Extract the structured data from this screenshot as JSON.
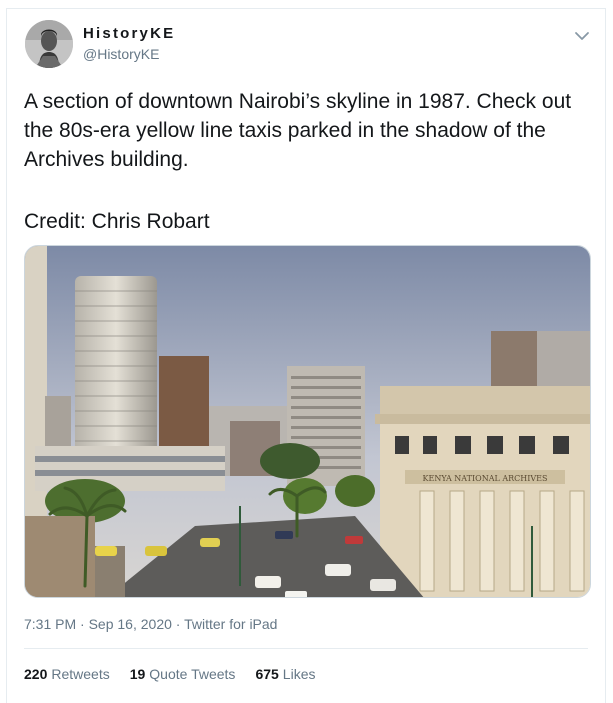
{
  "author": {
    "display_name": "HistoryKE",
    "handle": "@HistoryKE"
  },
  "tweet": {
    "text": "A section of downtown Nairobi’s skyline in 1987. Check out the 80s-era yellow line taxis parked in the shadow of the Archives building.",
    "credit": "Credit: Chris Robart"
  },
  "photo": {
    "building_sign": "KENYA NATIONAL ARCHIVES"
  },
  "meta": {
    "time": "7:31 PM",
    "sep1": " · ",
    "date": "Sep 16, 2020",
    "sep2": " · ",
    "source": "Twitter for iPad"
  },
  "stats": {
    "retweets_count": "220",
    "retweets_label": "Retweets",
    "quote_count": "19",
    "quote_label": "Quote Tweets",
    "likes_count": "675",
    "likes_label": "Likes"
  },
  "colors": {
    "text": "#14171a",
    "secondary": "#657786",
    "border": "#e6ecf0"
  }
}
